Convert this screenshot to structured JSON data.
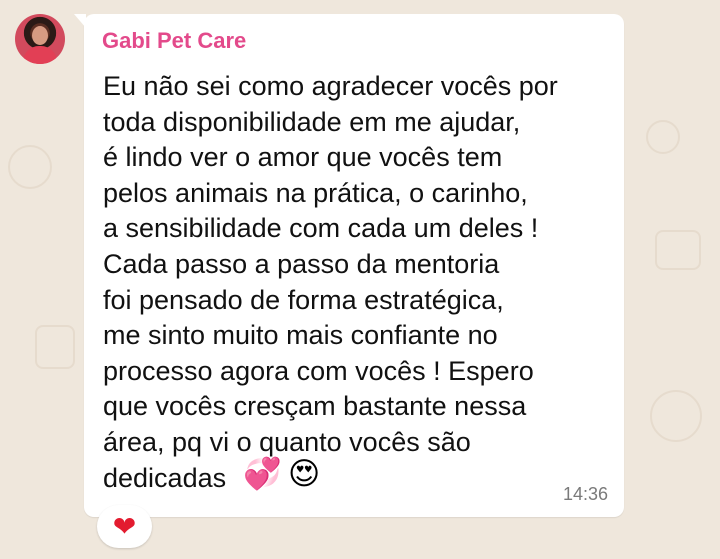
{
  "chat": {
    "sender_name": "Gabi Pet Care",
    "message_text": "Eu não sei como agradecer vocês por\ntoda disponibilidade em me ajudar,\né lindo ver o amor que vocês tem\npelos animais na prática, o carinho,\na sensibilidade com cada um deles !\nCada passo a passo da mentoria\nfoi pensado de forma estratégica,\nme sinto muito mais confiante no\nprocesso agora com vocês ! Espero\nque vocês cresçam bastante nessa\nárea, pq vi o quanto vocês são\ndedicadas",
    "emoji_hearts": "💞",
    "emoji_love_face": "😍",
    "timestamp": "14:36",
    "reaction_emoji": "❤"
  },
  "colors": {
    "background": "#efe7dc",
    "bubble": "#ffffff",
    "sender_name": "#e34a8b",
    "text": "#111111",
    "timestamp": "#7a7a7a",
    "reaction_heart": "#e31b2f"
  },
  "icons": {
    "avatar": "avatar-image",
    "reaction": "red-heart-icon"
  }
}
